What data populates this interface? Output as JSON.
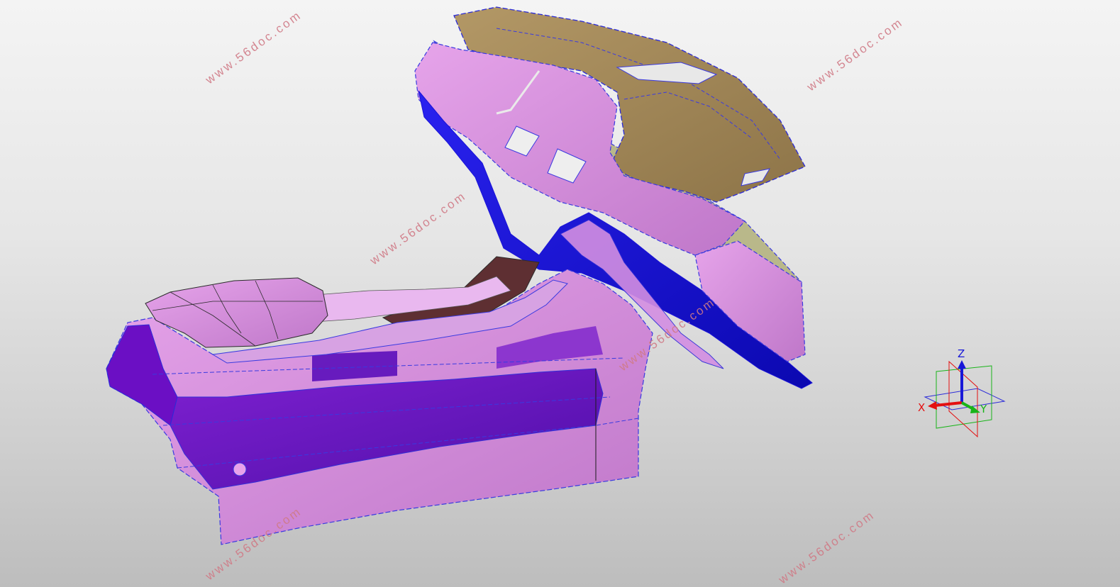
{
  "watermark": {
    "text": "www.56doc.com",
    "instances": 6
  },
  "model": {
    "colors": {
      "panel_pink": "#c77fd0",
      "panel_light": "#e59ae6",
      "shadow_purple": "#6b0fc4",
      "deep_blue": "#1a14d8",
      "dash_tan": "#a98b5c",
      "khaki": "#b9b88a",
      "tunnel_brown": "#5e2f32",
      "edge_blue": "#2030e0"
    }
  },
  "triad": {
    "x_label": "X",
    "y_label": "Y",
    "z_label": "Z",
    "colors": {
      "x": "#e41010",
      "y": "#19b419",
      "z": "#1818d8",
      "plane": "#2b2bd8"
    }
  }
}
